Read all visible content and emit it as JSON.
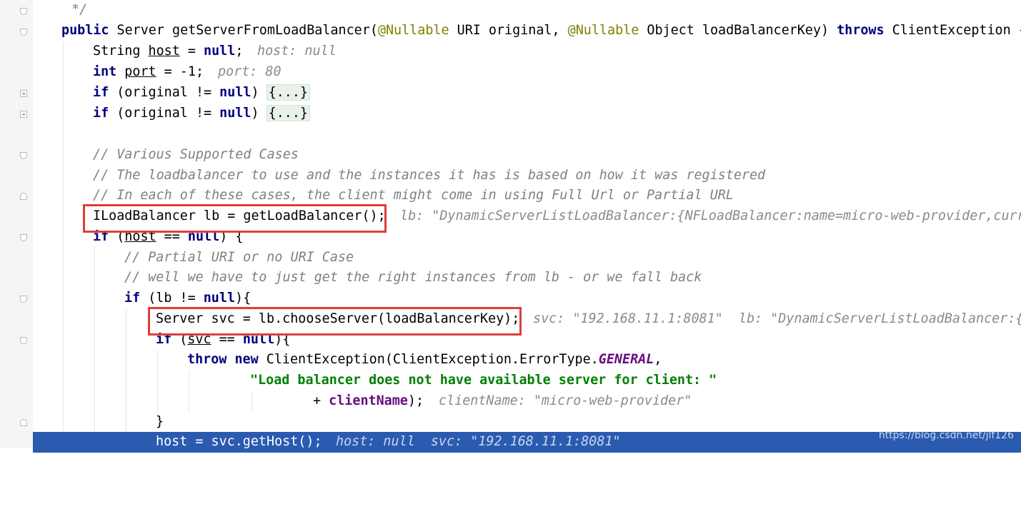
{
  "editor": {
    "language": "Java",
    "colors": {
      "background": "#ffffff",
      "gutter": "#f5f5f5",
      "keyword": "#000080",
      "annotation": "#808000",
      "comment": "#808080",
      "string": "#008000",
      "field": "#660e7a",
      "current_line": "#2a5bb0",
      "highlight_box": "#e03c3c"
    },
    "lines": [
      {
        "text": "*/",
        "type": "comment"
      },
      {
        "kw1": "public",
        "t1": " Server getServerFromLoadBalancer(",
        "anno1": "@Nullable",
        "t2": " URI original, ",
        "anno2": "@Nullable",
        "t3": " Object loadBalancerKey) ",
        "kw2": "throws",
        "t4": " ClientException {"
      },
      {
        "a": "String ",
        "var": "host",
        "b": " = ",
        "kw": "null",
        "c": ";",
        "hint": "host: null"
      },
      {
        "kw1": "int",
        "a": " ",
        "var": "port",
        "b": " = -1;",
        "hint": "port: 80"
      },
      {
        "kw1": "if",
        "a": " (original != ",
        "kw2": "null",
        "b": ") ",
        "folded": "{...}"
      },
      {
        "kw1": "if",
        "a": " (original != ",
        "kw2": "null",
        "b": ") ",
        "folded": "{...}"
      },
      {
        "text": "// Various Supported Cases",
        "type": "comment"
      },
      {
        "text": "// The loadbalancer to use and the instances it has is based on how it was registered",
        "type": "comment"
      },
      {
        "text": "// In each of these cases, the client might come in using Full Url or Partial URL",
        "type": "comment"
      },
      {
        "code": "ILoadBalancer lb = getLoadBalancer();",
        "hint": "lb: \"DynamicServerListLoadBalancer:{NFLoadBalancer:name=micro-web-provider,curr"
      },
      {
        "kw1": "if",
        "a": " (",
        "var": "host",
        "b": " == ",
        "kw2": "null",
        "c": ") {"
      },
      {
        "text": "// Partial URI or no URI Case",
        "type": "comment"
      },
      {
        "text": "// well we have to just get the right instances from lb - or we fall back",
        "type": "comment"
      },
      {
        "kw1": "if",
        "a": " (lb != ",
        "kw2": "null",
        "b": "){"
      },
      {
        "code": "Server svc = lb.chooseServer(loadBalancerKey);",
        "hint": "svc: \"192.168.11.1:8081\"  lb: \"DynamicServerListLoadBalancer:{"
      },
      {
        "kw1": "if",
        "a": " (",
        "var": "svc",
        "b": " == ",
        "kw2": "null",
        "c": "){"
      },
      {
        "kw1": "throw",
        "a": " ",
        "kw2": "new",
        "b": " ClientException(ClientException.ErrorType.",
        "constant": "GENERAL",
        "c": ","
      },
      {
        "text": "\"Load balancer does not have available server for client: \"",
        "type": "string"
      },
      {
        "a": "+ ",
        "field": "clientName",
        "b": ");",
        "hint": "clientName: \"micro-web-provider\""
      },
      {
        "text": "}",
        "type": "plain"
      },
      {
        "a": "host = svc.getHost();",
        "hint": "host: null  svc: \"192.168.11.1:8081\""
      }
    ]
  },
  "watermark": "https://blog.csdn.net/jlf126"
}
